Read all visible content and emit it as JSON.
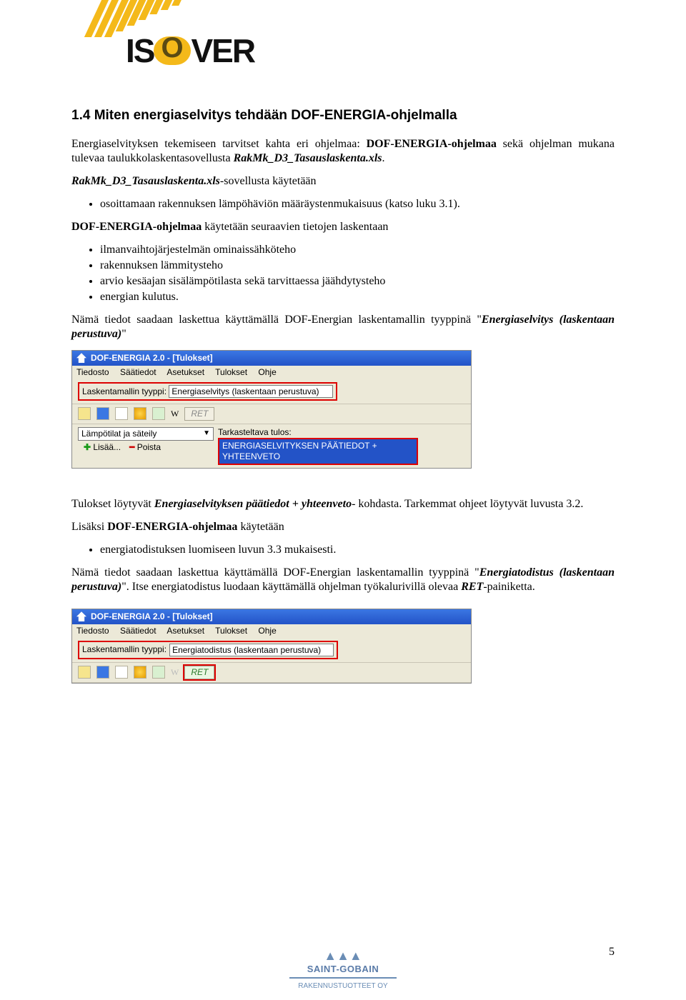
{
  "header": {
    "brand": "ISOVER"
  },
  "section": {
    "heading": "1.4 Miten energiaselvitys tehdään DOF-ENERGIA-ohjelmalla",
    "p1a": "Energiaselvityksen tekemiseen tarvitset kahta eri ohjelmaa: ",
    "p1b": "DOF-ENERGIA-ohjelmaa",
    "p1c": " sekä ohjelman mukana tulevaa taulukkolaskentasovellusta ",
    "p1d": "RakMk_D3_Tasauslaskenta.xls",
    "p1e": ".",
    "p2a": "RakMk_D3_Tasauslaskenta.xls",
    "p2b": "-sovellusta käytetään",
    "li1": "osoittamaan rakennuksen lämpöhäviön määräystenmukaisuus (katso luku 3.1).",
    "p3a": "DOF-ENERGIA-ohjelmaa",
    "p3b": " käytetään seuraavien tietojen laskentaan",
    "li2": "ilmanvaihtojärjestelmän ominaissähköteho",
    "li3": "rakennuksen lämmitysteho",
    "li4": "arvio kesäajan sisälämpötilasta sekä tarvittaessa jäähdytysteho",
    "li5": "energian kulutus.",
    "p4a": "Nämä tiedot saadaan laskettua käyttämällä DOF-Energian laskentamallin tyyppinä \"",
    "p4b": "Energiaselvitys (laskentaan perustuva)",
    "p4c": "\"",
    "p5a": "Tulokset löytyvät ",
    "p5b": "Energiaselvityksen päätiedot + yhteenveto",
    "p5c": "- kohdasta. Tarkemmat ohjeet löytyvät luvusta 3.2.",
    "p6a": "Lisäksi ",
    "p6b": "DOF-ENERGIA-ohjelmaa",
    "p6c": " käytetään",
    "li6": "energiatodistuksen luomiseen luvun 3.3 mukaisesti.",
    "p7a": "Nämä tiedot saadaan laskettua käyttämällä DOF-Energian laskentamallin tyyppinä \"",
    "p7b": "Energiatodistus (laskentaan perustuva)",
    "p7c": "\". Itse energiatodistus luodaan käyttämällä ohjelman työkalurivillä olevaa ",
    "p7d": "RET",
    "p7e": "-painiketta."
  },
  "win1": {
    "title": "DOF-ENERGIA 2.0 - [Tulokset]",
    "menu": {
      "m1": "Tiedosto",
      "m2": "Säätiedot",
      "m3": "Asetukset",
      "m4": "Tulokset",
      "m5": "Ohje"
    },
    "typeLabel": "Laskentamallin tyyppi:",
    "typeValue": "Energiaselvitys (laskentaan perustuva)",
    "toolW": "W",
    "ret": "RET",
    "dropdownValue": "Lämpötilat ja säteily",
    "add": "Lisää...",
    "remove": "Poista",
    "resultLabel": "Tarkasteltava tulos:",
    "resultValue": "ENERGIASELVITYKSEN PÄÄTIEDOT + YHTEENVETO"
  },
  "win2": {
    "title": "DOF-ENERGIA 2.0 - [Tulokset]",
    "menu": {
      "m1": "Tiedosto",
      "m2": "Säätiedot",
      "m3": "Asetukset",
      "m4": "Tulokset",
      "m5": "Ohje"
    },
    "typeLabel": "Laskentamallin tyyppi:",
    "typeValue": "Energiatodistus (laskentaan perustuva)",
    "toolW": "W",
    "ret": "RET"
  },
  "page": {
    "num": "5"
  },
  "footer": {
    "sg": "SAINT-GOBAIN",
    "sub": "RAKENNUSTUOTTEET OY"
  }
}
